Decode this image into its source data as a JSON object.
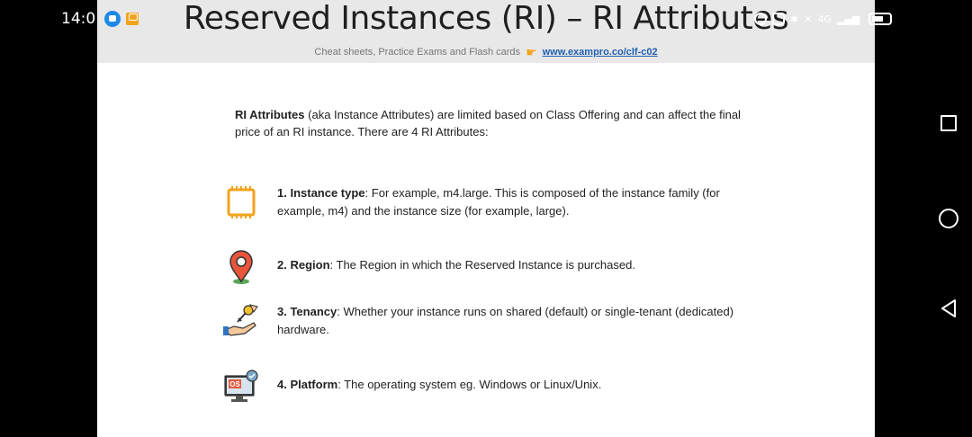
{
  "status_bar": {
    "time": "14:0",
    "signal_text": "4G"
  },
  "slide": {
    "title": "Reserved Instances (RI) – RI Attributes",
    "subtitle": "Cheat sheets, Practice Exams and Flash cards",
    "link": "www.exampro.co/clf-c02",
    "intro": {
      "bold": "RI Attributes",
      "rest": " (aka Instance Attributes) are limited based on Class Offering and can affect the final price of an RI instance. There are 4 RI Attributes:"
    },
    "attributes": [
      {
        "name": "1. Instance type",
        "description": ": For example, m4.large. This is composed of the instance family (for example, m4) and the instance size (for example, large).",
        "icon": "chip-icon"
      },
      {
        "name": "2. Region",
        "description": ": The Region in which the Reserved Instance is purchased.",
        "icon": "map-pin-icon"
      },
      {
        "name": "3. Tenancy",
        "description": ": Whether your instance runs on shared (default) or single-tenant (dedicated) hardware.",
        "icon": "hand-key-icon"
      },
      {
        "name": "4. Platform",
        "description": ": The operating system eg. Windows or Linux/Unix.",
        "icon": "os-monitor-icon",
        "icon_label": "OS"
      }
    ]
  },
  "colors": {
    "header_bg": "#e8e8e8",
    "link": "#1f5fae",
    "chip": "#f2a31b",
    "pin": "#e8553b",
    "os": "#e25a3c"
  }
}
